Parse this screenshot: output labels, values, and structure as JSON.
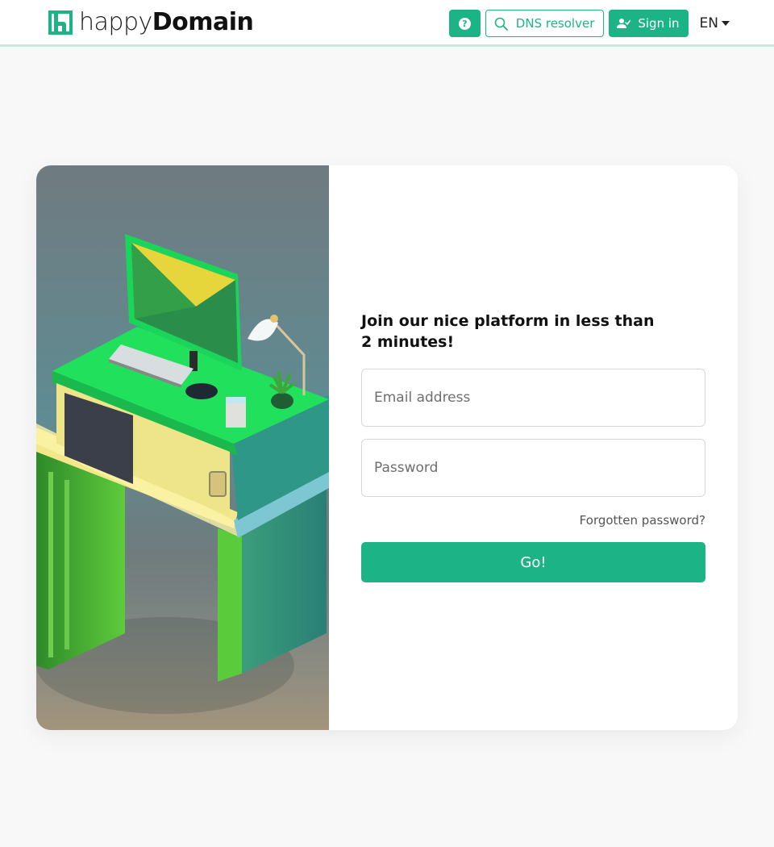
{
  "brand": {
    "name_light": "happy",
    "name_bold": "Domain",
    "accent": "#1cb487"
  },
  "navbar": {
    "help_label": "?",
    "dns_label": "DNS resolver",
    "signin_label": "Sign in",
    "lang_label": "EN"
  },
  "login": {
    "headline": "Join our nice platform in less than 2 minutes!",
    "email_placeholder": "Email address",
    "password_placeholder": "Password",
    "forgot_label": "Forgotten password?",
    "submit_label": "Go!"
  }
}
